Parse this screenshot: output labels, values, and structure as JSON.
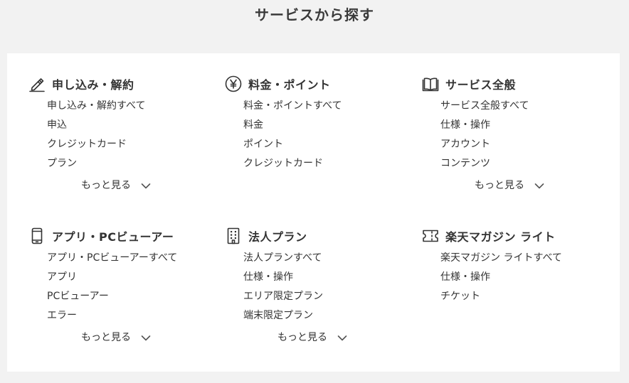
{
  "page": {
    "title": "サービスから探す"
  },
  "more_label": "もっと見る",
  "categories": [
    {
      "title": "申し込み・解約",
      "icon": "pencil-icon",
      "links": [
        "申し込み・解約すべて",
        "申込",
        "クレジットカード",
        "プラン"
      ],
      "has_more": true
    },
    {
      "title": "料金・ポイント",
      "icon": "yen-coin-icon",
      "links": [
        "料金・ポイントすべて",
        "料金",
        "ポイント",
        "クレジットカード"
      ],
      "has_more": false
    },
    {
      "title": "サービス全般",
      "icon": "open-book-icon",
      "links": [
        "サービス全般すべて",
        "仕様・操作",
        "アカウント",
        "コンテンツ"
      ],
      "has_more": true
    },
    {
      "title": "アプリ・PCビューアー",
      "icon": "smartphone-icon",
      "links": [
        "アプリ・PCビューアーすべて",
        "アプリ",
        "PCビューアー",
        "エラー"
      ],
      "has_more": true
    },
    {
      "title": "法人プラン",
      "icon": "office-building-icon",
      "links": [
        "法人プランすべて",
        "仕様・操作",
        "エリア限定プラン",
        "端末限定プラン"
      ],
      "has_more": true
    },
    {
      "title": "楽天マガジン ライト",
      "icon": "ticket-icon",
      "links": [
        "楽天マガジン ライトすべて",
        "仕様・操作",
        "チケット"
      ],
      "has_more": false
    }
  ]
}
